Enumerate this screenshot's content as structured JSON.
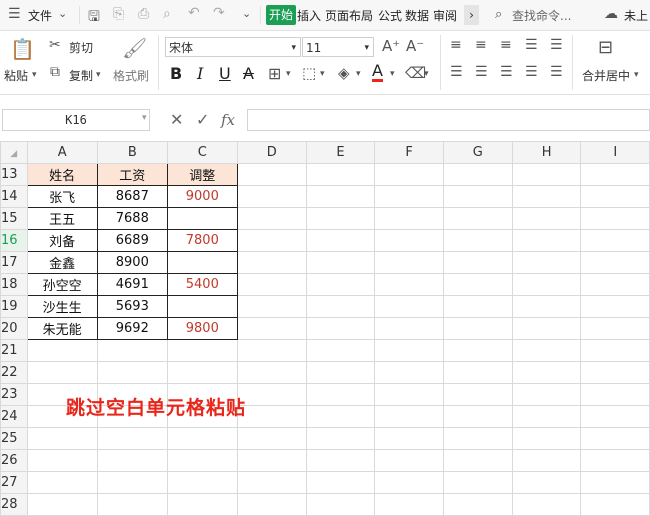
{
  "menubar": {
    "file": "文件",
    "tabs": [
      "开始",
      "插入",
      "页面布局",
      "公式",
      "数据",
      "审阅"
    ],
    "search_placeholder": "查找命令...",
    "cloud": "未上"
  },
  "ribbon": {
    "paste": "粘贴",
    "cut": "剪切",
    "copy": "复制",
    "format_painter": "格式刷",
    "font_name": "宋体",
    "font_size": "11",
    "merge_center": "合并居中"
  },
  "formula_bar": {
    "name_box": "K16",
    "fx": "fx",
    "value": ""
  },
  "grid": {
    "columns": [
      "A",
      "B",
      "C",
      "D",
      "E",
      "F",
      "G",
      "H",
      "I"
    ],
    "rows": [
      {
        "num": "13",
        "cells": [
          "姓名",
          "工资",
          "调整"
        ]
      },
      {
        "num": "14",
        "cells": [
          "张飞",
          "8687",
          "9000"
        ]
      },
      {
        "num": "15",
        "cells": [
          "王五",
          "7688",
          ""
        ]
      },
      {
        "num": "16",
        "cells": [
          "刘备",
          "6689",
          "7800"
        ]
      },
      {
        "num": "17",
        "cells": [
          "金鑫",
          "8900",
          ""
        ]
      },
      {
        "num": "18",
        "cells": [
          "孙空空",
          "4691",
          "5400"
        ]
      },
      {
        "num": "19",
        "cells": [
          "沙生生",
          "5693",
          ""
        ]
      },
      {
        "num": "20",
        "cells": [
          "朱无能",
          "9692",
          "9800"
        ]
      },
      {
        "num": "21",
        "cells": [
          "",
          "",
          ""
        ]
      },
      {
        "num": "22",
        "cells": [
          "",
          "",
          ""
        ]
      },
      {
        "num": "23",
        "cells": [
          "",
          "",
          ""
        ]
      },
      {
        "num": "24",
        "cells": [
          "",
          "",
          ""
        ]
      },
      {
        "num": "25",
        "cells": [
          "",
          "",
          ""
        ]
      },
      {
        "num": "26",
        "cells": [
          "",
          "",
          ""
        ]
      },
      {
        "num": "27",
        "cells": [
          "",
          "",
          ""
        ]
      },
      {
        "num": "28",
        "cells": [
          "",
          "",
          ""
        ]
      }
    ],
    "active_row": "16"
  },
  "overlay": "跳过空白单元格粘贴",
  "colors": {
    "accent": "#1a9f55",
    "header_fill": "#fce4d6",
    "adjust_text": "#c0392b",
    "overlay_text": "#e8261b"
  }
}
